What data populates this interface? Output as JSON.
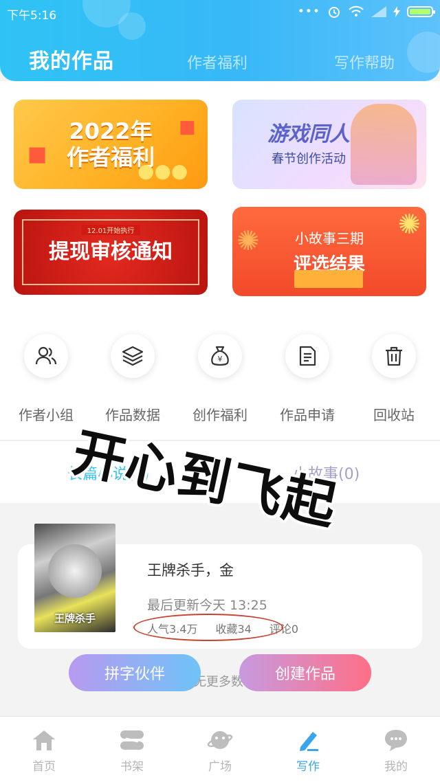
{
  "status": {
    "time": "下午5:16",
    "more": "•••"
  },
  "header": {
    "tabs": [
      {
        "label": "我的作品",
        "active": true
      },
      {
        "label": "作者福利",
        "active": false
      },
      {
        "label": "写作帮助",
        "active": false
      }
    ]
  },
  "banners": [
    {
      "line1": "2022年",
      "line2": "作者福利"
    },
    {
      "line1": "游戏同人",
      "line2": "春节创作活动"
    },
    {
      "tag": "12.01开始执行",
      "line1": "提现审核通知"
    },
    {
      "line1": "小故事三期",
      "line2": "评选结果"
    }
  ],
  "shortcuts": [
    {
      "label": "作者小组",
      "icon": "users-icon"
    },
    {
      "label": "作品数据",
      "icon": "layers-icon"
    },
    {
      "label": "创作福利",
      "icon": "money-bag-icon"
    },
    {
      "label": "作品申请",
      "icon": "document-icon"
    },
    {
      "label": "回收站",
      "icon": "trash-icon"
    }
  ],
  "section_tabs": {
    "long": "长篇小说(1)",
    "short": "小故事(0)"
  },
  "work": {
    "cover_text": "王牌杀手",
    "title": "王牌杀手，金",
    "updated": "最后更新今天 13:25",
    "popularity": "人气3.4万",
    "favorites": "收藏34",
    "comments": "评论0"
  },
  "more_text": "无更多数",
  "buttons": {
    "partner": "拼字伙伴",
    "create": "创建作品"
  },
  "sticker": "开心到飞起",
  "nav": [
    {
      "label": "首页",
      "icon": "home-icon",
      "active": false
    },
    {
      "label": "书架",
      "icon": "bookshelf-icon",
      "active": false
    },
    {
      "label": "广场",
      "icon": "planet-icon",
      "active": false
    },
    {
      "label": "写作",
      "icon": "pen-icon",
      "active": true
    },
    {
      "label": "我的",
      "icon": "chat-bubble-icon",
      "active": false
    }
  ],
  "colors": {
    "accent": "#39c2f5",
    "active_nav": "#3aa5ec",
    "create_btn": "#ff6f86"
  }
}
